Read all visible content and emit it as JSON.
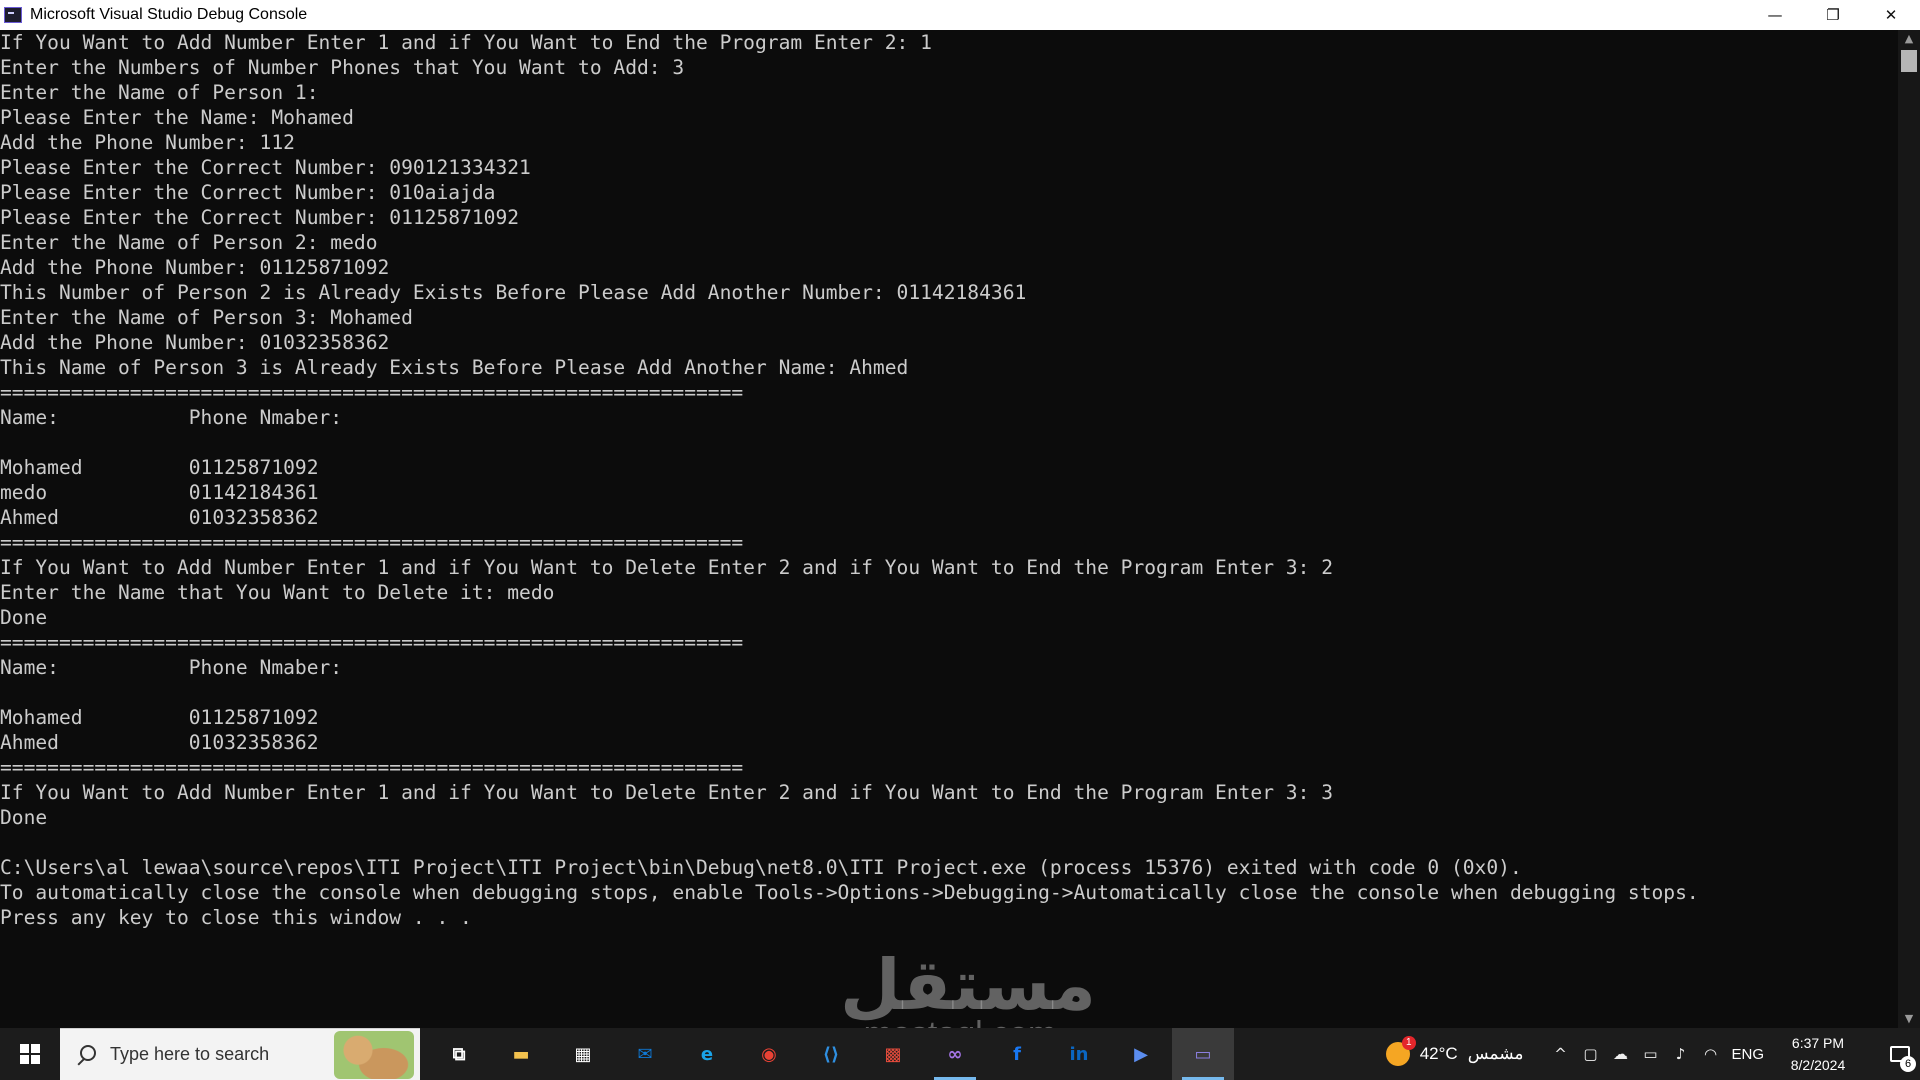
{
  "window": {
    "title": "Microsoft Visual Studio Debug Console",
    "minimize": "—",
    "restore": "❐",
    "close": "✕"
  },
  "console": {
    "lines": [
      "If You Want to Add Number Enter 1 and if You Want to End the Program Enter 2: 1",
      "Enter the Numbers of Number Phones that You Want to Add: 3",
      "Enter the Name of Person 1:",
      "Please Enter the Name: Mohamed",
      "Add the Phone Number: 112",
      "Please Enter the Correct Number: 090121334321",
      "Please Enter the Correct Number: 010aiajda",
      "Please Enter the Correct Number: 01125871092",
      "Enter the Name of Person 2: medo",
      "Add the Phone Number: 01125871092",
      "This Number of Person 2 is Already Exists Before Please Add Another Number: 01142184361",
      "Enter the Name of Person 3: Mohamed",
      "Add the Phone Number: 01032358362",
      "This Name of Person 3 is Already Exists Before Please Add Another Name: Ahmed",
      "===============================================================",
      "Name:           Phone Nmaber:",
      "",
      "Mohamed         01125871092",
      "medo            01142184361",
      "Ahmed           01032358362",
      "===============================================================",
      "If You Want to Add Number Enter 1 and if You Want to Delete Enter 2 and if You Want to End the Program Enter 3: 2",
      "Enter the Name that You Want to Delete it: medo",
      "Done",
      "===============================================================",
      "Name:           Phone Nmaber:",
      "",
      "Mohamed         01125871092",
      "Ahmed           01032358362",
      "===============================================================",
      "If You Want to Add Number Enter 1 and if You Want to Delete Enter 2 and if You Want to End the Program Enter 3: 3",
      "Done",
      "",
      "C:\\Users\\al lewaa\\source\\repos\\ITI Project\\ITI Project\\bin\\Debug\\net8.0\\ITI Project.exe (process 15376) exited with code 0 (0x0).",
      "To automatically close the console when debugging stops, enable Tools->Options->Debugging->Automatically close the console when debugging stops.",
      "Press any key to close this window . . ."
    ],
    "text_color": "#cccccc",
    "background": "#0c0c0c"
  },
  "watermark": {
    "arabic": "مستقل",
    "latin": "mostaql.com"
  },
  "taskbar": {
    "search_placeholder": "Type here to search",
    "icons": [
      {
        "name": "task-view-icon",
        "glyph": "⧉",
        "color": "#ffffff"
      },
      {
        "name": "file-explorer-icon",
        "glyph": "▬",
        "color": "#f2c14e"
      },
      {
        "name": "microsoft-store-icon",
        "glyph": "▦",
        "color": "#ffffff"
      },
      {
        "name": "mail-icon",
        "glyph": "✉",
        "color": "#0f78d4"
      },
      {
        "name": "edge-icon",
        "glyph": "e",
        "color": "#1aa3e8"
      },
      {
        "name": "chrome-icon",
        "glyph": "◉",
        "color": "#e94235"
      },
      {
        "name": "vscode-icon",
        "glyph": "⟨⟩",
        "color": "#2f8fe0"
      },
      {
        "name": "office-icon",
        "glyph": "▩",
        "color": "#e74c3c"
      },
      {
        "name": "visual-studio-preview-icon",
        "glyph": "∞",
        "color": "#a675e8"
      },
      {
        "name": "facebook-icon",
        "glyph": "f",
        "color": "#1877f2"
      },
      {
        "name": "linkedin-icon",
        "glyph": "in",
        "color": "#0a66c2"
      },
      {
        "name": "copilot-icon",
        "glyph": "▶",
        "color": "#5b8def"
      },
      {
        "name": "debug-console-icon",
        "glyph": "▭",
        "color": "#8b7fe0"
      }
    ],
    "weather": {
      "badge": "1",
      "temperature": "42°C",
      "condition": "مشمس"
    },
    "tray": {
      "chevron": "^",
      "language": "ENG",
      "time": "6:37 PM",
      "date": "8/2/2024",
      "notification_count": "6"
    }
  }
}
